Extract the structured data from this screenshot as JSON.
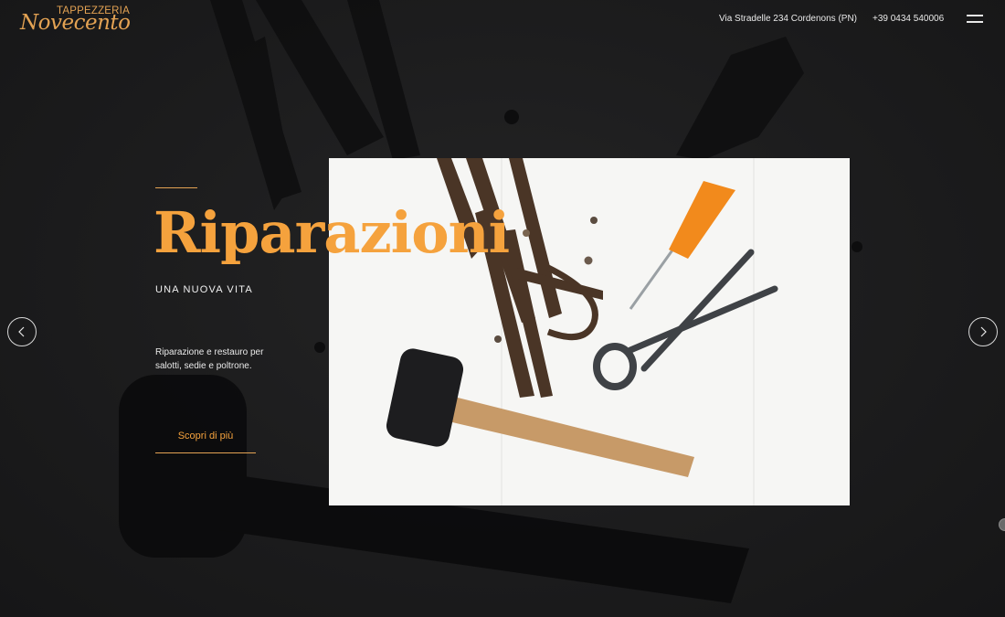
{
  "header": {
    "logo_top": "TAPPEZZERIA",
    "logo_script": "Novecento",
    "address": "Via Stradelle 234 Cordenons (PN)",
    "phone": "+39 0434 540006",
    "menu_icon": "hamburger-icon"
  },
  "hero": {
    "title": "Riparazioni",
    "subtitle": "UNA NUOVA VITA",
    "description": "Riparazione e restauro per salotti, sedie e poltrone.",
    "cta_label": "Scopri di più"
  },
  "slider": {
    "prev_icon": "chevron-left-icon",
    "next_icon": "chevron-right-icon"
  },
  "colors": {
    "accent": "#f5a23d",
    "background": "#1a1a1b",
    "photo_background": "#f6f6f4"
  }
}
